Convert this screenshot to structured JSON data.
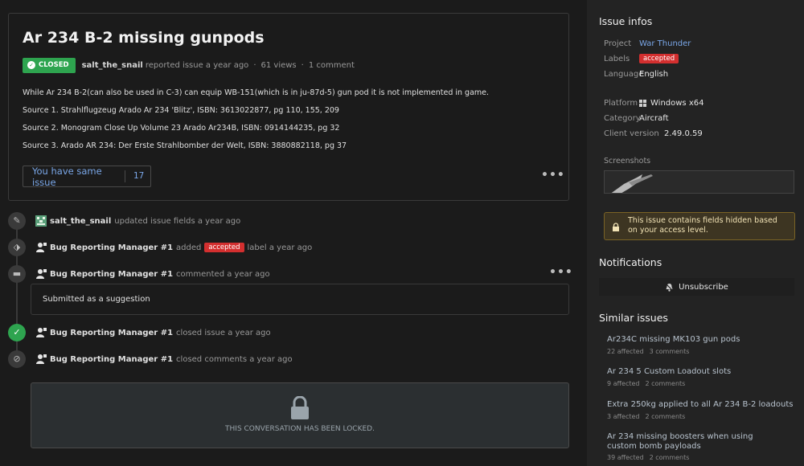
{
  "issue": {
    "title": "Ar 234 B-2 missing gunpods",
    "status": "CLOSED",
    "author": "salt_the_snail",
    "reported": "reported issue a year ago",
    "views": "61 views",
    "comments": "1 comment",
    "description": [
      "While Ar 234 B-2(can also be used in C-3) can equip WB-151(which is in ju-87d-5) gun pod it is not implemented in game.",
      "Source 1. Strahlflugzeug Arado Ar 234 'Blitz', ISBN: 3613022877, pg 110, 155, 209",
      "Source 2. Monogram Close Up Volume 23 Arado Ar234B, ISBN: 0914144235, pg 32",
      "Source 3. Arado AR 234: Der Erste Strahlbomber der Welt, ISBN: 3880882118, pg 37"
    ],
    "same_issue_label": "You have same issue",
    "same_issue_count": "17",
    "more": "•••"
  },
  "timeline": [
    {
      "who": "salt_the_snail",
      "action": "updated issue fields a year ago",
      "icon": "pencil-icon"
    },
    {
      "who": "Bug Reporting Manager #1",
      "action": "added",
      "label": "accepted",
      "after": "label a year ago",
      "icon": "tag-icon"
    },
    {
      "who": "Bug Reporting Manager #1",
      "action": "commented a year ago",
      "icon": "comment-icon"
    },
    {
      "who": "Bug Reporting Manager #1",
      "action": "closed issue a year ago",
      "icon": "check-circle-icon"
    },
    {
      "who": "Bug Reporting Manager #1",
      "action": "closed comments a year ago",
      "icon": "comment-off-icon"
    }
  ],
  "comment_text": "Submitted as a suggestion",
  "locked_text": "THIS CONVERSATION HAS BEEN LOCKED.",
  "sidebar": {
    "infos_title": "Issue infos",
    "project_k": "Project",
    "project_v": "War Thunder",
    "labels_k": "Labels",
    "labels_v": "accepted",
    "language_k": "Language",
    "language_v": "English",
    "platform_k": "Platform",
    "platform_v": "Windows x64",
    "category_k": "Category",
    "category_v": "Aircraft",
    "client_k": "Client version",
    "client_v": "2.49.0.59",
    "screenshots_k": "Screenshots",
    "notice": "This issue contains fields hidden based on your access level.",
    "notifications_title": "Notifications",
    "unsubscribe": "Unsubscribe",
    "similar_title": "Similar issues",
    "similar": [
      {
        "title": "Ar234C missing MK103 gun pods",
        "affected": "22 affected",
        "comments": "3 comments"
      },
      {
        "title": "Ar 234 5 Custom Loadout slots",
        "affected": "9 affected",
        "comments": "2 comments"
      },
      {
        "title": "Extra 250kg applied to all Ar 234 B-2 loadouts",
        "affected": "3 affected",
        "comments": "2 comments"
      },
      {
        "title": "Ar 234 missing boosters when using custom bomb payloads",
        "affected": "39 affected",
        "comments": "2 comments"
      }
    ]
  },
  "colors": {
    "closed": "#2ea44f",
    "accepted": "#d32f2f",
    "link": "#7aa7e8",
    "notice_bg": "#3d3522"
  }
}
